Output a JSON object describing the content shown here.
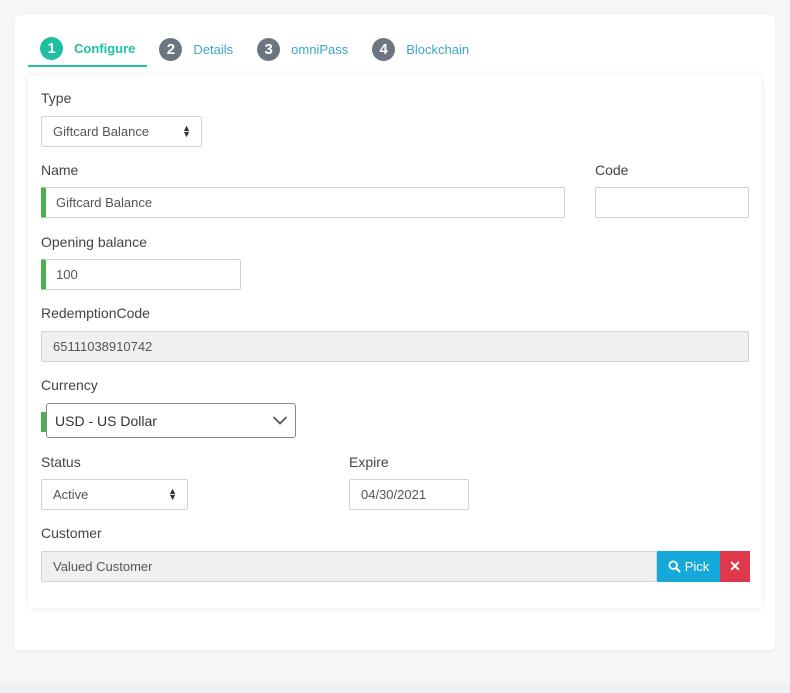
{
  "tabs": [
    {
      "num": "1",
      "label": "Configure",
      "active": true
    },
    {
      "num": "2",
      "label": "Details"
    },
    {
      "num": "3",
      "label": "omniPass"
    },
    {
      "num": "4",
      "label": "Blockchain"
    }
  ],
  "form": {
    "type": {
      "label": "Type",
      "value": "Giftcard Balance"
    },
    "name": {
      "label": "Name",
      "value": "Giftcard Balance"
    },
    "code": {
      "label": "Code",
      "value": ""
    },
    "opening_balance": {
      "label": "Opening balance",
      "value": "100"
    },
    "redemption_code": {
      "label": "RedemptionCode",
      "value": "65111038910742"
    },
    "currency": {
      "label": "Currency",
      "value": "USD - US Dollar"
    },
    "status": {
      "label": "Status",
      "value": "Active"
    },
    "expire": {
      "label": "Expire",
      "value": "04/30/2021"
    },
    "customer": {
      "label": "Customer",
      "value": "Valued Customer",
      "pick_label": "Pick",
      "clear_label": "✕"
    }
  },
  "colors": {
    "accent": "#1fc0a0",
    "valid": "#4caf50",
    "pick": "#14a9d9",
    "danger": "#e0374a"
  }
}
